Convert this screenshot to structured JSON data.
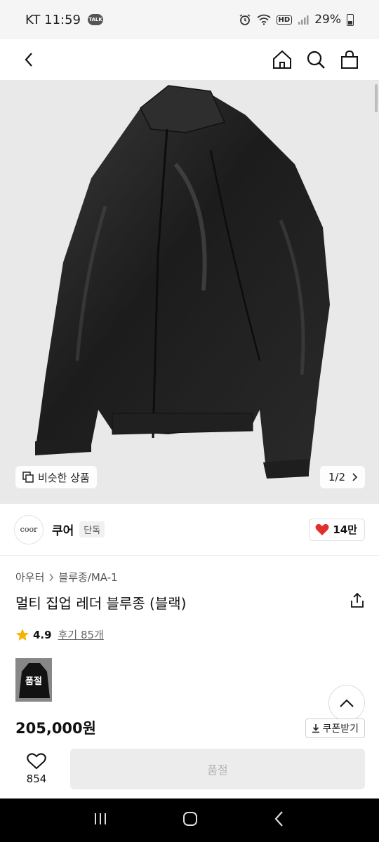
{
  "status_bar": {
    "carrier_time": "KT 11:59",
    "talk_badge": "TALK",
    "hd": "HD",
    "battery": "29%"
  },
  "gallery": {
    "similar_button": "비슷한 상품",
    "pager": "1/2"
  },
  "brand": {
    "logo_text": "coor",
    "name": "쿠어",
    "badge": "단독",
    "likes": "14만"
  },
  "product": {
    "breadcrumb": [
      "아우터",
      "블루종/MA-1"
    ],
    "title": "멀티 집업 레더 블루종 (블랙)",
    "rating": "4.9",
    "reviews": "후기 85개",
    "thumbnail_label": "품절",
    "price": "205,000원",
    "coupon_button": "쿠폰받기"
  },
  "bottom_bar": {
    "wish_count": "854",
    "soldout_button": "품절"
  },
  "colors": {
    "heart": "#e0302b",
    "star": "#f5b400",
    "disabled_text": "#b3b3b3"
  }
}
